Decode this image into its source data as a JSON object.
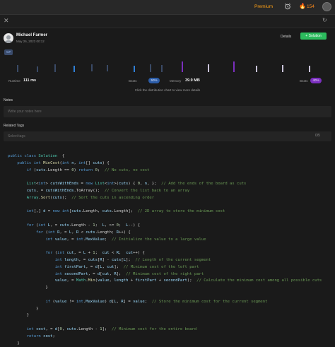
{
  "header": {
    "premium_label": "Premium",
    "alarm_icon": "alarm-clock-icon",
    "fire_icon": "fire-icon",
    "streak_count": "154",
    "avatar_icon": "user-avatar-icon"
  },
  "subheader": {
    "close_icon": "close-icon",
    "close_glyph": "✕",
    "refresh_icon": "refresh-icon",
    "refresh_glyph": "↻"
  },
  "submission": {
    "author": "Michael Farmer",
    "date": "May 26, 2023 00:12",
    "details_label": "Details",
    "solution_label": "+ Solution",
    "language": "C#"
  },
  "stats": {
    "runtime_label": "Runtime",
    "runtime_value": "111 ms",
    "runtime_beats_label": "Beats",
    "runtime_beats": "50%",
    "memory_label": "Memory",
    "memory_value": "39.9 MB",
    "memory_beats_label": "Beats",
    "memory_beats": "40%",
    "hint": "Click the distribution chart to view more details"
  },
  "distribution_chart": {
    "colors": {
      "runtime": "#2f7fd6",
      "runtime_dim": "#3a4a66",
      "memory": "#7b2fbf",
      "memory_dim": "#c9c3d9"
    }
  },
  "notes": {
    "label": "Notes",
    "placeholder": "Write your notes here"
  },
  "tags": {
    "label": "Related Tags",
    "placeholder": "Select tags",
    "count": "0/5"
  },
  "code_lines": [
    [
      [
        "kw",
        "public class "
      ],
      [
        "ty",
        "Solution"
      ],
      [
        "",
        "  {"
      ]
    ],
    [
      [
        "",
        "    "
      ],
      [
        "kw",
        "public int "
      ],
      [
        "fn",
        "MinCost"
      ],
      [
        "",
        "("
      ],
      [
        "kw",
        "int "
      ],
      [
        "vr",
        "n"
      ],
      [
        "",
        ", "
      ],
      [
        "kw",
        "int"
      ],
      [
        "",
        "[] "
      ],
      [
        "vr",
        "cuts"
      ],
      [
        "",
        ") {"
      ]
    ],
    [
      [
        "",
        "        "
      ],
      [
        "kw",
        "if "
      ],
      [
        "",
        "("
      ],
      [
        "vr",
        "cuts"
      ],
      [
        "",
        ".Length == "
      ],
      [
        "nm",
        "0"
      ],
      [
        "",
        ") "
      ],
      [
        "kw",
        "return "
      ],
      [
        "nm",
        "0"
      ],
      [
        "",
        ";  "
      ],
      [
        "cm",
        "// No cuts, no cost"
      ]
    ],
    [
      [
        "",
        ""
      ]
    ],
    [
      [
        "",
        "        "
      ],
      [
        "ty",
        "List"
      ],
      [
        "",
        "<"
      ],
      [
        "kw",
        "int"
      ],
      [
        "",
        "> "
      ],
      [
        "vr",
        "cutsWithEnds"
      ],
      [
        "",
        " = "
      ],
      [
        "kw",
        "new "
      ],
      [
        "ty",
        "List"
      ],
      [
        "",
        "<"
      ],
      [
        "kw",
        "int"
      ],
      [
        "",
        ">("
      ],
      [
        "vr",
        "cuts"
      ],
      [
        "",
        ") { "
      ],
      [
        "nm",
        "0"
      ],
      [
        "",
        ", "
      ],
      [
        "vr",
        "n"
      ],
      [
        "",
        ", };  "
      ],
      [
        "cm",
        "// Add the ends of the board as cuts"
      ]
    ],
    [
      [
        "",
        "        "
      ],
      [
        "vr",
        "cuts"
      ],
      [
        "",
        ", = "
      ],
      [
        "vr",
        "cutsWithEnds"
      ],
      [
        "",
        ".ToArray();  "
      ],
      [
        "cm",
        "// Convert the list back to an array"
      ]
    ],
    [
      [
        "",
        "        "
      ],
      [
        "ty",
        "Array"
      ],
      [
        "",
        "."
      ],
      [
        "fn",
        "Sort"
      ],
      [
        "",
        "("
      ],
      [
        "vr",
        "cuts"
      ],
      [
        "",
        ");  "
      ],
      [
        "cm",
        "// Sort the cuts in ascending order"
      ]
    ],
    [
      [
        "",
        ""
      ]
    ],
    [
      [
        "",
        "        "
      ],
      [
        "kw",
        "int"
      ],
      [
        "",
        "[,] "
      ],
      [
        "vr",
        "d"
      ],
      [
        "",
        " = "
      ],
      [
        "kw",
        "new int"
      ],
      [
        "",
        "["
      ],
      [
        "vr",
        "cuts"
      ],
      [
        "",
        ".Length, "
      ],
      [
        "vr",
        "cuts"
      ],
      [
        "",
        ".Length];  "
      ],
      [
        "cm",
        "// 2D array to store the minimum cost"
      ]
    ],
    [
      [
        "",
        ""
      ]
    ],
    [
      [
        "",
        "        "
      ],
      [
        "kw",
        "for "
      ],
      [
        "",
        "("
      ],
      [
        "kw",
        "int "
      ],
      [
        "vr",
        "L"
      ],
      [
        "",
        ", = "
      ],
      [
        "vr",
        "cuts"
      ],
      [
        "",
        ".Length - "
      ],
      [
        "nm",
        "1"
      ],
      [
        "",
        ";  "
      ],
      [
        "vr",
        "L"
      ],
      [
        "",
        ", >= "
      ],
      [
        "nm",
        "0"
      ],
      [
        "",
        ";  "
      ],
      [
        "vr",
        "L"
      ],
      [
        "",
        "--) {"
      ]
    ],
    [
      [
        "",
        "            "
      ],
      [
        "kw",
        "for "
      ],
      [
        "",
        "("
      ],
      [
        "kw",
        "int "
      ],
      [
        "vr",
        "R"
      ],
      [
        "",
        ", = "
      ],
      [
        "vr",
        "L"
      ],
      [
        "",
        ", "
      ],
      [
        "vr",
        "R"
      ],
      [
        "",
        " < "
      ],
      [
        "vr",
        "cuts"
      ],
      [
        "",
        ".Length; "
      ],
      [
        "vr",
        "R"
      ],
      [
        "",
        "++) {"
      ]
    ],
    [
      [
        "",
        "                "
      ],
      [
        "kw",
        "int "
      ],
      [
        "vr",
        "value"
      ],
      [
        "",
        ", = "
      ],
      [
        "kw",
        "int"
      ],
      [
        "",
        "."
      ],
      [
        "vr",
        "MaxValue"
      ],
      [
        "",
        ";  "
      ],
      [
        "cm",
        "// Initialize the value to a large value"
      ]
    ],
    [
      [
        "",
        ""
      ]
    ],
    [
      [
        "",
        "                "
      ],
      [
        "kw",
        "for "
      ],
      [
        "",
        "("
      ],
      [
        "kw",
        "int "
      ],
      [
        "vr",
        "cut"
      ],
      [
        "",
        ", = "
      ],
      [
        "vr",
        "L"
      ],
      [
        "",
        " + "
      ],
      [
        "nm",
        "1"
      ],
      [
        "",
        ";  "
      ],
      [
        "vr",
        "cut"
      ],
      [
        "",
        " < "
      ],
      [
        "vr",
        "R"
      ],
      [
        "",
        ";  "
      ],
      [
        "vr",
        "cut"
      ],
      [
        "",
        "++) {"
      ]
    ],
    [
      [
        "",
        "                    "
      ],
      [
        "kw",
        "int "
      ],
      [
        "vr",
        "length"
      ],
      [
        "",
        ", = "
      ],
      [
        "vr",
        "cuts"
      ],
      [
        "",
        "["
      ],
      [
        "vr",
        "R"
      ],
      [
        "",
        "] - "
      ],
      [
        "vr",
        "cuts"
      ],
      [
        "",
        "["
      ],
      [
        "vr",
        "L"
      ],
      [
        "",
        "];  "
      ],
      [
        "cm",
        "// Length of the current segment"
      ]
    ],
    [
      [
        "",
        "                    "
      ],
      [
        "kw",
        "int "
      ],
      [
        "vr",
        "firstPart"
      ],
      [
        "",
        ", = "
      ],
      [
        "vr",
        "d"
      ],
      [
        "",
        "["
      ],
      [
        "vr",
        "L"
      ],
      [
        "",
        ", "
      ],
      [
        "vr",
        "cut"
      ],
      [
        "",
        "];  "
      ],
      [
        "cm",
        "// Minimum cost of the left part"
      ]
    ],
    [
      [
        "",
        "                    "
      ],
      [
        "kw",
        "int "
      ],
      [
        "vr",
        "secondPart"
      ],
      [
        "",
        ", = "
      ],
      [
        "vr",
        "d"
      ],
      [
        "",
        "["
      ],
      [
        "vr",
        "cut"
      ],
      [
        "",
        ", "
      ],
      [
        "vr",
        "R"
      ],
      [
        "",
        "];  "
      ],
      [
        "cm",
        "// Minimum cost of the right part"
      ]
    ],
    [
      [
        "",
        "                    "
      ],
      [
        "vr",
        "value"
      ],
      [
        "",
        ", = "
      ],
      [
        "ty",
        "Math"
      ],
      [
        "",
        "."
      ],
      [
        "fn",
        "Min"
      ],
      [
        "",
        "("
      ],
      [
        "vr",
        "value"
      ],
      [
        "",
        ", "
      ],
      [
        "vr",
        "length"
      ],
      [
        "",
        " + "
      ],
      [
        "vr",
        "firstPart"
      ],
      [
        "",
        " + "
      ],
      [
        "vr",
        "secondPart"
      ],
      [
        "",
        ");  "
      ],
      [
        "cm",
        "// Calculate the minimum cost among all possible cuts"
      ]
    ],
    [
      [
        "",
        "                }"
      ]
    ],
    [
      [
        "",
        ""
      ]
    ],
    [
      [
        "",
        "                "
      ],
      [
        "kw",
        "if "
      ],
      [
        "",
        "("
      ],
      [
        "vr",
        "value"
      ],
      [
        "",
        " != "
      ],
      [
        "kw",
        "int"
      ],
      [
        "",
        "."
      ],
      [
        "vr",
        "MaxValue"
      ],
      [
        "",
        ") "
      ],
      [
        "vr",
        "d"
      ],
      [
        "",
        "["
      ],
      [
        "vr",
        "L"
      ],
      [
        "",
        ", "
      ],
      [
        "vr",
        "R"
      ],
      [
        "",
        "] = "
      ],
      [
        "vr",
        "value"
      ],
      [
        "",
        ";  "
      ],
      [
        "cm",
        "// Store the minimum cost for the current segment"
      ]
    ],
    [
      [
        "",
        "            }"
      ]
    ],
    [
      [
        "",
        "        }"
      ]
    ],
    [
      [
        "",
        ""
      ]
    ],
    [
      [
        "",
        "        "
      ],
      [
        "kw",
        "int "
      ],
      [
        "vr",
        "cost"
      ],
      [
        "",
        ", = "
      ],
      [
        "vr",
        "d"
      ],
      [
        "",
        "["
      ],
      [
        "nm",
        "0"
      ],
      [
        "",
        ", "
      ],
      [
        "vr",
        "cuts"
      ],
      [
        "",
        ".Length - "
      ],
      [
        "nm",
        "1"
      ],
      [
        "",
        "];  "
      ],
      [
        "cm",
        "// Minimum cost for the entire board"
      ]
    ],
    [
      [
        "",
        "        "
      ],
      [
        "kw",
        "return "
      ],
      [
        "vr",
        "cost"
      ],
      [
        "",
        ";"
      ]
    ],
    [
      [
        "",
        "    }"
      ]
    ]
  ]
}
